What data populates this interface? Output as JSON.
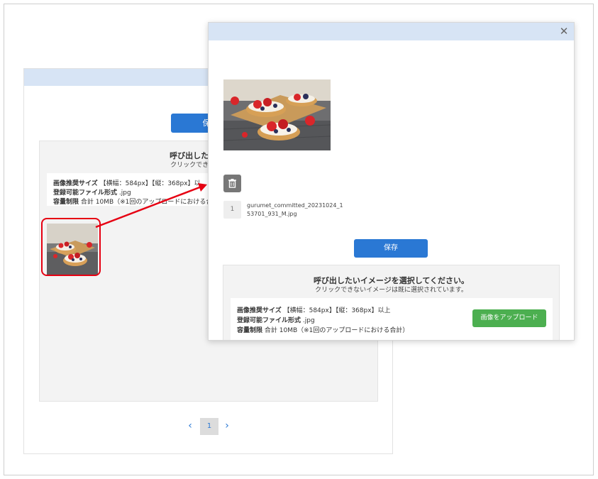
{
  "back_panel": {
    "save_label": "保",
    "title": "呼び出したいイメージ",
    "subtitle": "クリックできないイメージ",
    "info": {
      "size_label": "画像推奨サイズ",
      "size_value": "【横幅：584px】【縦：368px】以",
      "format_label": "登録可能ファイル形式",
      "format_value": ".jpg",
      "capacity_label": "容量制限",
      "capacity_value": "合計 10MB（※1回のアップロードにおける合計）"
    },
    "pagination": {
      "prev_icon": "chevron-left-icon",
      "current_page": "1",
      "next_icon": "chevron-right-icon"
    }
  },
  "modal": {
    "close_icon": "close-icon",
    "trash_icon": "trash-icon",
    "file_index": "1",
    "file_name": "gurumet_committed_20231024_153701_931_M.jpg",
    "save_label": "保存",
    "title": "呼び出したいイメージを選択してください。",
    "subtitle": "クリックできないイメージは既に選択されています。",
    "info": {
      "size_label": "画像推奨サイズ",
      "size_value": "【横幅：584px】【縦：368px】以上",
      "format_label": "登録可能ファイル形式",
      "format_value": ".jpg",
      "capacity_label": "容量制限",
      "capacity_value": "合計 10MB（※1回のアップロードにおける合計）"
    },
    "upload_label": "画像をアップロード"
  },
  "colors": {
    "header": "#d7e4f5",
    "primary": "#2a78d4",
    "upload": "#4caf50",
    "highlight": "#e60012"
  }
}
